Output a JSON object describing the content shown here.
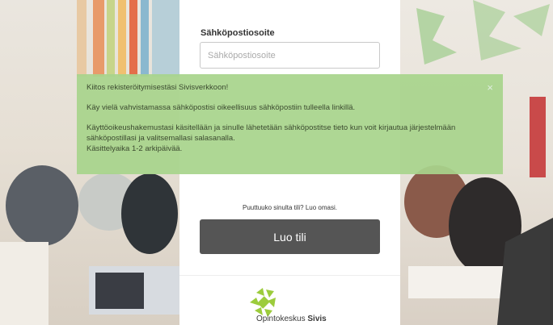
{
  "form": {
    "email_label": "Sähköpostiosoite",
    "email_placeholder": "Sähköpostiosoite",
    "signup_prompt": "Puuttuuko sinulta tili? Luo omasi.",
    "create_account_button": "Luo tili"
  },
  "alert": {
    "line1": "Kiitos rekisteröitymisestäsi Sivisverkkoon!",
    "line2": "Käy vielä vahvistamassa sähköpostisi oikeellisuus sähköpostiin tulleella linkillä.",
    "line3": "Käyttöoikeushakemustasi käsitellään ja sinulle lähetetään sähköpostitse tieto kun voit kirjautua järjestelmään sähköpostillasi ja valitsemallasi salasanalla.",
    "line4": "Käsittelyaika 1-2 arkipäivää.",
    "close_symbol": "×",
    "color": "#a8d48c"
  },
  "logo": {
    "name_prefix": "Opintokeskus ",
    "name_bold": "Sivis",
    "color": "#9ccc3c"
  }
}
